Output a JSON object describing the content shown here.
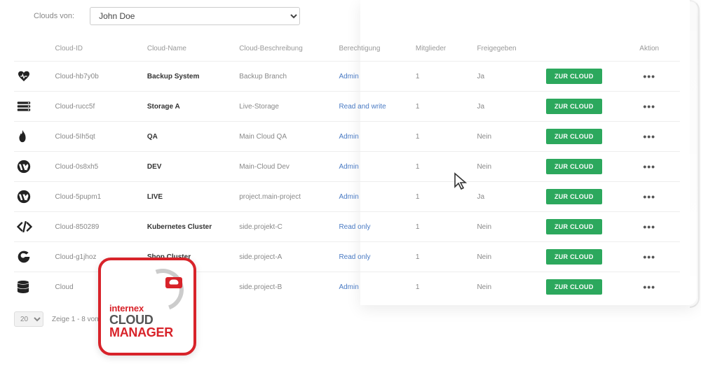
{
  "filter": {
    "label": "Clouds von:",
    "selected": "John Doe"
  },
  "headers": {
    "cloud_id": "Cloud-ID",
    "cloud_name": "Cloud-Name",
    "cloud_desc": "Cloud-Beschreibung",
    "permission": "Berechtigung",
    "members": "Mitglieder",
    "shared": "Freigegeben",
    "action": "Aktion"
  },
  "button_label": "ZUR CLOUD",
  "rows": [
    {
      "icon": "heartbeat",
      "id": "Cloud-hb7y0b",
      "name": "Backup System",
      "desc": "Backup Branch",
      "perm": "Admin",
      "members": "1",
      "shared": "Ja"
    },
    {
      "icon": "server",
      "id": "Cloud-rucc5f",
      "name": "Storage A",
      "desc": "Live-Storage",
      "perm": "Read and write",
      "members": "1",
      "shared": "Ja"
    },
    {
      "icon": "flame",
      "id": "Cloud-5Ih5qt",
      "name": "QA",
      "desc": "Main Cloud QA",
      "perm": "Admin",
      "members": "1",
      "shared": "Nein"
    },
    {
      "icon": "wordpress",
      "id": "Cloud-0s8xh5",
      "name": "DEV",
      "desc": "Main-Cloud Dev",
      "perm": "Admin",
      "members": "1",
      "shared": "Nein"
    },
    {
      "icon": "wordpress",
      "id": "Cloud-5pupm1",
      "name": "LIVE",
      "desc": "project.main-project",
      "perm": "Admin",
      "members": "1",
      "shared": "Ja"
    },
    {
      "icon": "code",
      "id": "Cloud-850289",
      "name": "Kubernetes Cluster",
      "desc": "side.projekt-C",
      "perm": "Read only",
      "members": "1",
      "shared": "Nein"
    },
    {
      "icon": "g",
      "id": "Cloud-g1jhoz",
      "name": "Shop Cluster",
      "desc": "side.project-A",
      "perm": "Read only",
      "members": "1",
      "shared": "Nein"
    },
    {
      "icon": "database",
      "id": "Cloud",
      "name": "",
      "desc": "side.project-B",
      "perm": "Admin",
      "members": "1",
      "shared": "Nein"
    }
  ],
  "pagination": {
    "page_size": "20",
    "info": "Zeige 1 - 8 von 8"
  },
  "logo": {
    "line1": "internex",
    "line2": "CLOUD",
    "line3": "MANAGER"
  }
}
